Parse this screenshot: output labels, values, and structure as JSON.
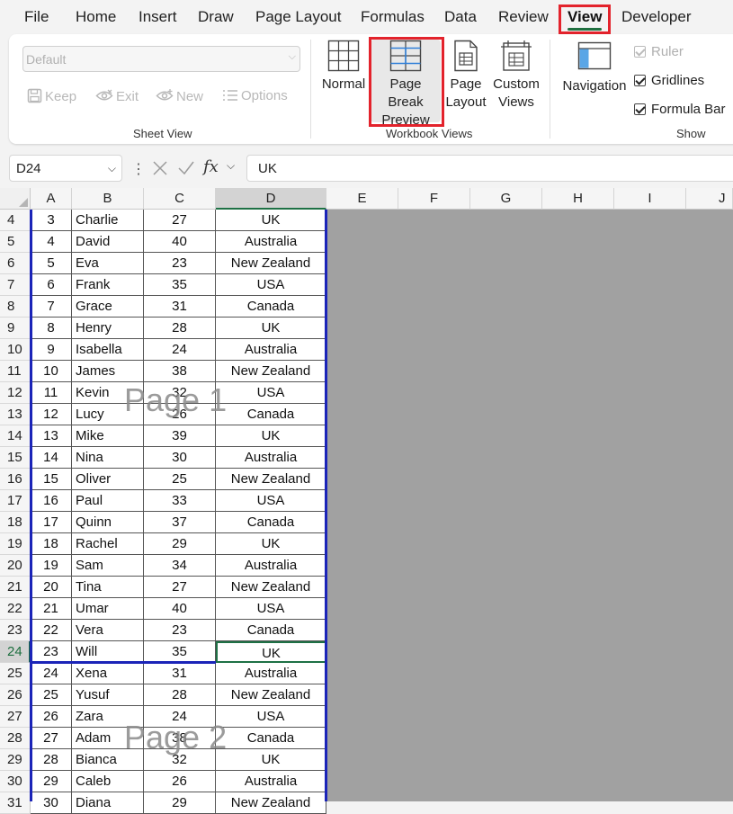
{
  "ribbon_tabs": [
    "File",
    "Home",
    "Insert",
    "Draw",
    "Page Layout",
    "Formulas",
    "Data",
    "Review",
    "View",
    "Developer"
  ],
  "active_tab": "View",
  "sheet_view": {
    "select_value": "Default",
    "keep": "Keep",
    "exit": "Exit",
    "new": "New",
    "options": "Options",
    "group_label": "Sheet View"
  },
  "workbook_views": {
    "normal": "Normal",
    "page_break_preview_1": "Page Break",
    "page_break_preview_2": "Preview",
    "page_layout_1": "Page",
    "page_layout_2": "Layout",
    "custom_views_1": "Custom",
    "custom_views_2": "Views",
    "group_label": "Workbook Views"
  },
  "show": {
    "navigation": "Navigation",
    "ruler": "Ruler",
    "gridlines": "Gridlines",
    "formula_bar": "Formula Bar",
    "group_label": "Show"
  },
  "formula_bar": {
    "name_box": "D24",
    "fx": "fx",
    "value": "UK"
  },
  "columns": [
    "A",
    "B",
    "C",
    "D",
    "E",
    "F",
    "G",
    "H",
    "I",
    "J"
  ],
  "selected_column": "D",
  "selected_row": "24",
  "rows": [
    {
      "row": "4",
      "a": "3",
      "b": "Charlie",
      "c": "27",
      "d": "UK"
    },
    {
      "row": "5",
      "a": "4",
      "b": "David",
      "c": "40",
      "d": "Australia"
    },
    {
      "row": "6",
      "a": "5",
      "b": "Eva",
      "c": "23",
      "d": "New Zealand"
    },
    {
      "row": "7",
      "a": "6",
      "b": "Frank",
      "c": "35",
      "d": "USA"
    },
    {
      "row": "8",
      "a": "7",
      "b": "Grace",
      "c": "31",
      "d": "Canada"
    },
    {
      "row": "9",
      "a": "8",
      "b": "Henry",
      "c": "28",
      "d": "UK"
    },
    {
      "row": "10",
      "a": "9",
      "b": "Isabella",
      "c": "24",
      "d": "Australia"
    },
    {
      "row": "11",
      "a": "10",
      "b": "James",
      "c": "38",
      "d": "New Zealand"
    },
    {
      "row": "12",
      "a": "11",
      "b": "Kevin",
      "c": "32",
      "d": "USA"
    },
    {
      "row": "13",
      "a": "12",
      "b": "Lucy",
      "c": "26",
      "d": "Canada"
    },
    {
      "row": "14",
      "a": "13",
      "b": "Mike",
      "c": "39",
      "d": "UK"
    },
    {
      "row": "15",
      "a": "14",
      "b": "Nina",
      "c": "30",
      "d": "Australia"
    },
    {
      "row": "16",
      "a": "15",
      "b": "Oliver",
      "c": "25",
      "d": "New Zealand"
    },
    {
      "row": "17",
      "a": "16",
      "b": "Paul",
      "c": "33",
      "d": "USA"
    },
    {
      "row": "18",
      "a": "17",
      "b": "Quinn",
      "c": "37",
      "d": "Canada"
    },
    {
      "row": "19",
      "a": "18",
      "b": "Rachel",
      "c": "29",
      "d": "UK"
    },
    {
      "row": "20",
      "a": "19",
      "b": "Sam",
      "c": "34",
      "d": "Australia"
    },
    {
      "row": "21",
      "a": "20",
      "b": "Tina",
      "c": "27",
      "d": "New Zealand"
    },
    {
      "row": "22",
      "a": "21",
      "b": "Umar",
      "c": "40",
      "d": "USA"
    },
    {
      "row": "23",
      "a": "22",
      "b": "Vera",
      "c": "23",
      "d": "Canada"
    },
    {
      "row": "24",
      "a": "23",
      "b": "Will",
      "c": "35",
      "d": "UK"
    },
    {
      "row": "25",
      "a": "24",
      "b": "Xena",
      "c": "31",
      "d": "Australia"
    },
    {
      "row": "26",
      "a": "25",
      "b": "Yusuf",
      "c": "28",
      "d": "New Zealand"
    },
    {
      "row": "27",
      "a": "26",
      "b": "Zara",
      "c": "24",
      "d": "USA"
    },
    {
      "row": "28",
      "a": "27",
      "b": "Adam",
      "c": "38",
      "d": "Canada"
    },
    {
      "row": "29",
      "a": "28",
      "b": "Bianca",
      "c": "32",
      "d": "UK"
    },
    {
      "row": "30",
      "a": "29",
      "b": "Caleb",
      "c": "26",
      "d": "Australia"
    },
    {
      "row": "31",
      "a": "30",
      "b": "Diana",
      "c": "29",
      "d": "New Zealand"
    }
  ],
  "page_labels": [
    "Page 1",
    "Page 2"
  ],
  "colors": {
    "highlight": "#e3232c",
    "page_break": "#1b24b8",
    "excel_green": "#1e7145"
  }
}
